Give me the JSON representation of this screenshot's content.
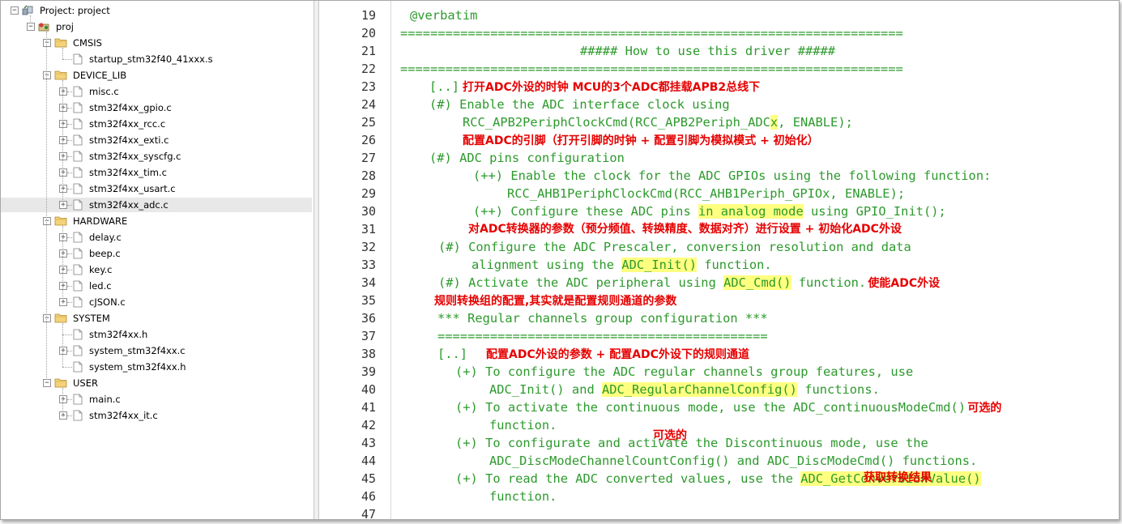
{
  "project_tree": {
    "root_label": "Project: project",
    "target_label": "proj",
    "groups": [
      {
        "name": "CMSIS",
        "files": [
          {
            "name": "startup_stm32f40_41xxx.s",
            "expandable": false
          }
        ]
      },
      {
        "name": "DEVICE_LIB",
        "files": [
          {
            "name": "misc.c",
            "expandable": true
          },
          {
            "name": "stm32f4xx_gpio.c",
            "expandable": true
          },
          {
            "name": "stm32f4xx_rcc.c",
            "expandable": true
          },
          {
            "name": "stm32f4xx_exti.c",
            "expandable": true
          },
          {
            "name": "stm32f4xx_syscfg.c",
            "expandable": true
          },
          {
            "name": "stm32f4xx_tim.c",
            "expandable": true
          },
          {
            "name": "stm32f4xx_usart.c",
            "expandable": true
          },
          {
            "name": "stm32f4xx_adc.c",
            "expandable": true,
            "selected": true
          }
        ]
      },
      {
        "name": "HARDWARE",
        "files": [
          {
            "name": "delay.c",
            "expandable": true
          },
          {
            "name": "beep.c",
            "expandable": true
          },
          {
            "name": "key.c",
            "expandable": true
          },
          {
            "name": "led.c",
            "expandable": true
          },
          {
            "name": "cJSON.c",
            "expandable": true
          }
        ]
      },
      {
        "name": "SYSTEM",
        "files": [
          {
            "name": "stm32f4xx.h",
            "expandable": false
          },
          {
            "name": "system_stm32f4xx.c",
            "expandable": true
          },
          {
            "name": "system_stm32f4xx.h",
            "expandable": false
          }
        ]
      },
      {
        "name": "USER",
        "files": [
          {
            "name": "main.c",
            "expandable": true
          },
          {
            "name": "stm32f4xx_it.c",
            "expandable": true
          }
        ]
      }
    ]
  },
  "editor": {
    "code_color": "#2d9a2d",
    "highlight_color": "#ffff80",
    "annotation_color": "#e60000",
    "lines": [
      {
        "num": "19",
        "segments": [
          {
            "t": "@verbatim"
          }
        ]
      },
      {
        "num": "20",
        "segments": [
          {
            "t": "==================================================================="
          }
        ]
      },
      {
        "num": "21",
        "segments": [
          {
            "t": "##### How to use this driver #####"
          }
        ]
      },
      {
        "num": "22",
        "segments": [
          {
            "t": "==================================================================="
          }
        ]
      },
      {
        "num": "23",
        "segments": [
          {
            "t": "[..]"
          }
        ]
      },
      {
        "num": "24",
        "segments": [
          {
            "t": "(#) Enable the ADC interface clock using"
          }
        ]
      },
      {
        "num": "25",
        "segments": [
          {
            "t": "RCC_APB2PeriphClockCmd(RCC_APB2Periph_ADC"
          },
          {
            "t": "x",
            "hl": true
          },
          {
            "t": ", ENABLE);"
          }
        ]
      },
      {
        "num": "26",
        "segments": []
      },
      {
        "num": "27",
        "segments": [
          {
            "t": "(#) ADC pins configuration"
          }
        ]
      },
      {
        "num": "28",
        "segments": [
          {
            "t": "(++) Enable the clock for the ADC GPIOs using the following function:"
          }
        ]
      },
      {
        "num": "29",
        "segments": [
          {
            "t": "RCC_AHB1PeriphClockCmd(RCC_AHB1Periph_GPIOx, ENABLE);"
          }
        ]
      },
      {
        "num": "30",
        "segments": [
          {
            "t": "(++) Configure these ADC pins "
          },
          {
            "t": "in analog mode",
            "hl": true
          },
          {
            "t": " using GPIO_Init();"
          }
        ]
      },
      {
        "num": "31",
        "segments": []
      },
      {
        "num": "32",
        "segments": [
          {
            "t": "(#) Configure the ADC Prescaler, conversion resolution and data"
          }
        ]
      },
      {
        "num": "33",
        "segments": [
          {
            "t": "alignment using the "
          },
          {
            "t": "ADC_Init()",
            "hl": true
          },
          {
            "t": " function."
          }
        ]
      },
      {
        "num": "34",
        "segments": [
          {
            "t": "(#) Activate the ADC peripheral using "
          },
          {
            "t": "ADC_Cmd()",
            "hl": true
          },
          {
            "t": " function."
          }
        ]
      },
      {
        "num": "35",
        "segments": []
      },
      {
        "num": "36",
        "segments": [
          {
            "t": "*** Regular channels group configuration ***"
          }
        ]
      },
      {
        "num": "37",
        "segments": [
          {
            "t": "============================================"
          }
        ]
      },
      {
        "num": "38",
        "segments": [
          {
            "t": "[..]"
          }
        ]
      },
      {
        "num": "39",
        "segments": [
          {
            "t": "(+) To configure the ADC regular channels group features, use"
          }
        ]
      },
      {
        "num": "40",
        "segments": [
          {
            "t": "ADC_Init() and "
          },
          {
            "t": "ADC_RegularChannelConfig()",
            "hl": true
          },
          {
            "t": " functions."
          }
        ]
      },
      {
        "num": "41",
        "segments": [
          {
            "t": "(+) To activate the continuous mode, use the ADC_continuousModeCmd()"
          }
        ]
      },
      {
        "num": "42",
        "segments": [
          {
            "t": "function."
          }
        ]
      },
      {
        "num": "43",
        "segments": [
          {
            "t": "(+) To configurate and activate the Discontinuous mode, use the"
          }
        ]
      },
      {
        "num": "44",
        "segments": [
          {
            "t": "ADC_DiscModeChannelCountConfig() and ADC_DiscModeCmd() functions."
          }
        ]
      },
      {
        "num": "45",
        "segments": [
          {
            "t": "(+) To read the ADC converted values, use the "
          },
          {
            "t": "ADC_GetConversionValue()",
            "hl": true
          }
        ]
      },
      {
        "num": "46",
        "segments": [
          {
            "t": "function."
          }
        ]
      },
      {
        "num": "47",
        "segments": []
      }
    ],
    "annotations": [
      {
        "line": 4,
        "text": "打开ADC外设的时钟  MCU的3个ADC都挂载APB2总线下"
      },
      {
        "line": 7,
        "text": "配置ADC的引脚（打开引脚的时钟 + 配置引脚为模拟模式 + 初始化）"
      },
      {
        "line": 12,
        "text": "对ADC转换器的参数（预分频值、转换精度、数据对齐）进行设置 + 初始化ADC外设"
      },
      {
        "line": 15,
        "text": "使能ADC外设"
      },
      {
        "line": 16,
        "text": "规则转换组的配置,其实就是配置规则通道的参数"
      },
      {
        "line": 19,
        "text": "配置ADC外设的参数 + 配置ADC外设下的规则通道"
      },
      {
        "line": 22,
        "text": "可选的"
      },
      {
        "line": 24,
        "text": "可选的"
      },
      {
        "line": 27,
        "text": "获取转换结果"
      }
    ]
  }
}
